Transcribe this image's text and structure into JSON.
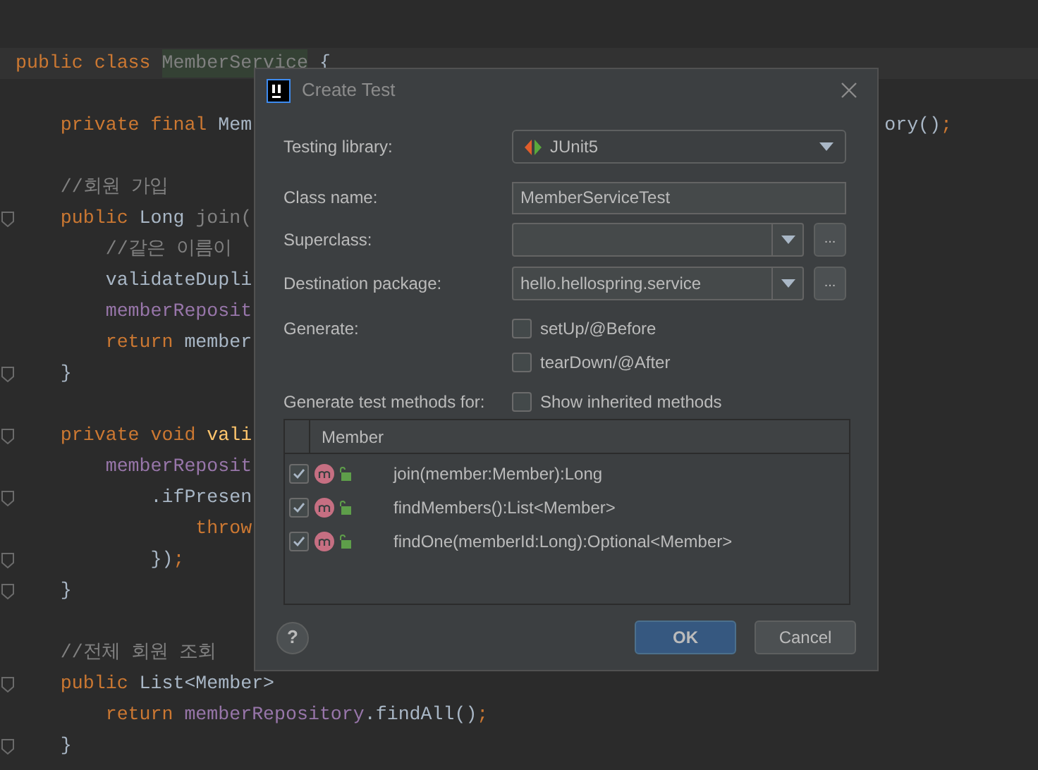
{
  "editor": {
    "lines": [
      {
        "kind": "line"
      },
      {
        "kind": "caret-line",
        "tokens": [
          {
            "kind": "kw",
            "text": "public class "
          },
          {
            "kind": "unused-highlight",
            "text": "MemberService"
          },
          {
            "kind": "plain",
            "text": " {"
          }
        ]
      },
      {
        "kind": "line"
      },
      {
        "kind": "line",
        "tokens": [
          {
            "kind": "kw",
            "text": "    private final "
          },
          {
            "kind": "plain",
            "text": "Mem"
          }
        ],
        "right": [
          {
            "kind": "plain",
            "text": "ory()"
          },
          {
            "kind": "kw",
            "text": ";"
          }
        ]
      },
      {
        "kind": "line"
      },
      {
        "kind": "line",
        "tokens": [
          {
            "kind": "comment",
            "text": "    //회원 가입"
          }
        ]
      },
      {
        "kind": "fold-line",
        "tokens": [
          {
            "kind": "kw",
            "text": "    public "
          },
          {
            "kind": "plain",
            "text": "Long "
          },
          {
            "kind": "unused",
            "text": "join("
          }
        ]
      },
      {
        "kind": "line",
        "tokens": [
          {
            "kind": "comment",
            "text": "        //같은 이름이"
          }
        ]
      },
      {
        "kind": "line",
        "tokens": [
          {
            "kind": "plain",
            "text": "        validateDupli"
          }
        ]
      },
      {
        "kind": "line",
        "tokens": [
          {
            "kind": "field",
            "text": "        memberReposit"
          }
        ]
      },
      {
        "kind": "line",
        "tokens": [
          {
            "kind": "kw",
            "text": "        return "
          },
          {
            "kind": "plain",
            "text": "member"
          }
        ]
      },
      {
        "kind": "fold-line",
        "tokens": [
          {
            "kind": "plain",
            "text": "    }"
          }
        ]
      },
      {
        "kind": "line"
      },
      {
        "kind": "fold-line",
        "tokens": [
          {
            "kind": "kw",
            "text": "    private void "
          },
          {
            "kind": "method",
            "text": "vali"
          }
        ]
      },
      {
        "kind": "line",
        "tokens": [
          {
            "kind": "field",
            "text": "        memberReposit"
          }
        ]
      },
      {
        "kind": "fold-line",
        "tokens": [
          {
            "kind": "plain",
            "text": "            .ifPresen"
          }
        ]
      },
      {
        "kind": "line",
        "tokens": [
          {
            "kind": "kw",
            "text": "                throw"
          }
        ]
      },
      {
        "kind": "fold-line",
        "tokens": [
          {
            "kind": "plain",
            "text": "            })"
          },
          {
            "kind": "kw",
            "text": ";"
          }
        ]
      },
      {
        "kind": "fold-line",
        "tokens": [
          {
            "kind": "plain",
            "text": "    }"
          }
        ]
      },
      {
        "kind": "line"
      },
      {
        "kind": "line",
        "tokens": [
          {
            "kind": "comment",
            "text": "    //전체 회원 조회"
          }
        ]
      },
      {
        "kind": "fold-line",
        "tokens": [
          {
            "kind": "kw",
            "text": "    public "
          },
          {
            "kind": "plain",
            "text": "List<Member>"
          }
        ]
      },
      {
        "kind": "line",
        "tokens": [
          {
            "kind": "kw",
            "text": "        return "
          },
          {
            "kind": "field",
            "text": "memberRepository"
          },
          {
            "kind": "plain",
            "text": ".findAll()"
          },
          {
            "kind": "kw",
            "text": ";"
          }
        ]
      },
      {
        "kind": "fold-line",
        "tokens": [
          {
            "kind": "plain",
            "text": "    }"
          }
        ]
      }
    ]
  },
  "dialog": {
    "title": "Create Test",
    "testing_library": {
      "label": "Testing library:",
      "value": "JUnit5"
    },
    "class_name": {
      "label": "Class name:",
      "value": "MemberServiceTest"
    },
    "superclass": {
      "label": "Superclass:",
      "browse": "..."
    },
    "destination_package": {
      "label": "Destination package:",
      "value": "hello.hellospring.service",
      "browse": "..."
    },
    "generate": {
      "label": "Generate:",
      "options": [
        {
          "label": "setUp/@Before",
          "checked": false
        },
        {
          "label": "tearDown/@After",
          "checked": false
        }
      ]
    },
    "methods_for": {
      "label": "Generate test methods for:",
      "show_inherited": {
        "label": "Show inherited methods",
        "checked": false
      }
    },
    "table": {
      "header": "Member",
      "rows": [
        {
          "signature": "join(member:Member):Long",
          "checked": true
        },
        {
          "signature": "findMembers():List<Member>",
          "checked": true
        },
        {
          "signature": "findOne(memberId:Long):Optional<Member>",
          "checked": true
        }
      ]
    },
    "help": "?",
    "buttons": [
      {
        "label": "OK",
        "kind": "primary"
      },
      {
        "label": "Cancel",
        "kind": "secondary"
      }
    ]
  }
}
